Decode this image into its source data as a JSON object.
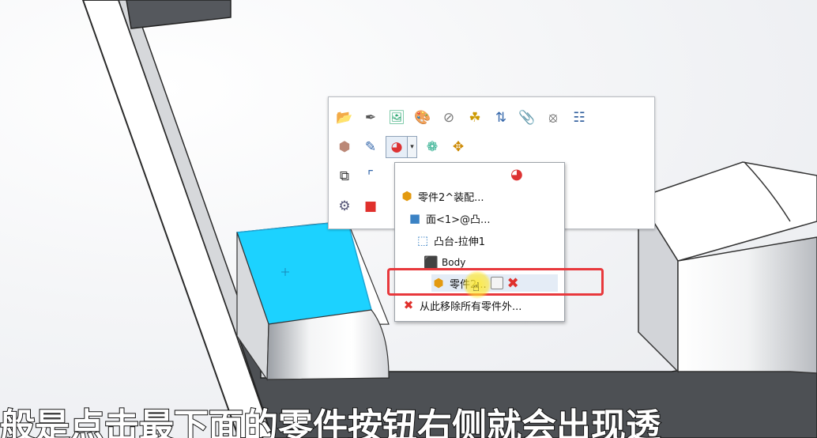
{
  "toolbar": {
    "row1": [
      "edit-feature-icon",
      "sketch-icon",
      "rebuild-icon",
      "appearance-icon",
      "hide-icon",
      "transparency-icon",
      "sort-icon",
      "paperclip-icon",
      "link-icon",
      "properties-icon"
    ],
    "row2": [
      "component-icon",
      "edit-sketch-icon",
      "appearance-dropdown-icon",
      "color-wheel-icon",
      "move-icon"
    ],
    "row3": [
      "copy-icon",
      "corner-icon"
    ],
    "row4": [
      "gear-body-icon",
      "red-cube-icon"
    ]
  },
  "menu": {
    "items": [
      {
        "label": "零件2^装配...",
        "icon": "part-icon"
      },
      {
        "label": "面<1>@凸...",
        "icon": "face-icon"
      },
      {
        "label": "凸台-拉伸1",
        "icon": "extrude-icon"
      },
      {
        "label": "Body",
        "icon": "body-icon"
      },
      {
        "label": "零件2...",
        "icon": "part-hand-icon"
      },
      {
        "label": "从此移除所有零件外...",
        "icon": "remove-icon"
      }
    ]
  },
  "subtitle": "般是点击最下面的零件按钮右侧就会出现透"
}
